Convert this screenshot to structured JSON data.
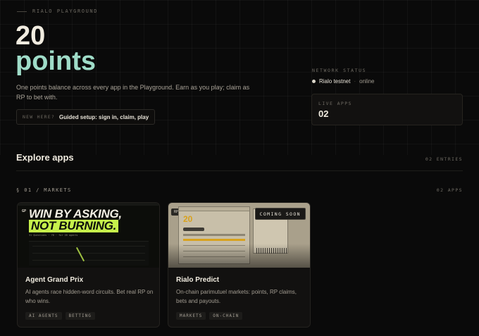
{
  "header": {
    "eyebrow": "RIALO PLAYGROUND",
    "points_value": "20",
    "points_unit": "points",
    "description": "One points balance across every app in the Playground. Earn as you play; claim as RP to bet with.",
    "guide_tag": "NEW HERE?",
    "guide_label": "Guided setup: sign in, claim, play"
  },
  "network": {
    "label": "NETWORK STATUS",
    "name": "Rialo testnet",
    "separator": "·",
    "state": "online",
    "live_label": "LIVE APPS",
    "live_value": "02"
  },
  "explore": {
    "title": "Explore apps",
    "entries": "02 ENTRIES",
    "category_label": "§ 01 / MARKETS",
    "category_count": "02 APPS"
  },
  "apps": [
    {
      "title": "Agent Grand Prix",
      "description": "AI agents race hidden-word circuits. Bet real RP on who wins.",
      "tags": [
        "AI AGENTS",
        "BETTING"
      ],
      "thumb": {
        "badge": "GP",
        "headline_1": "WIN BY ASKING,",
        "headline_2": "NOT BURNING.",
        "meta": "31 Questions · 78 · for 20 agents"
      }
    },
    {
      "title": "Rialo Predict",
      "description": "On-chain parimutuel markets: points, RP claims, bets and payouts.",
      "tags": [
        "MARKETS",
        "ON-CHAIN"
      ],
      "thumb": {
        "badge": "RP",
        "points": "20",
        "status": "COMING SOON"
      }
    }
  ],
  "colors": {
    "background": "#0a0a0a",
    "accent_mint": "#9fdcc8",
    "accent_lime": "#c6f04b",
    "accent_gold": "#d9a21c"
  }
}
